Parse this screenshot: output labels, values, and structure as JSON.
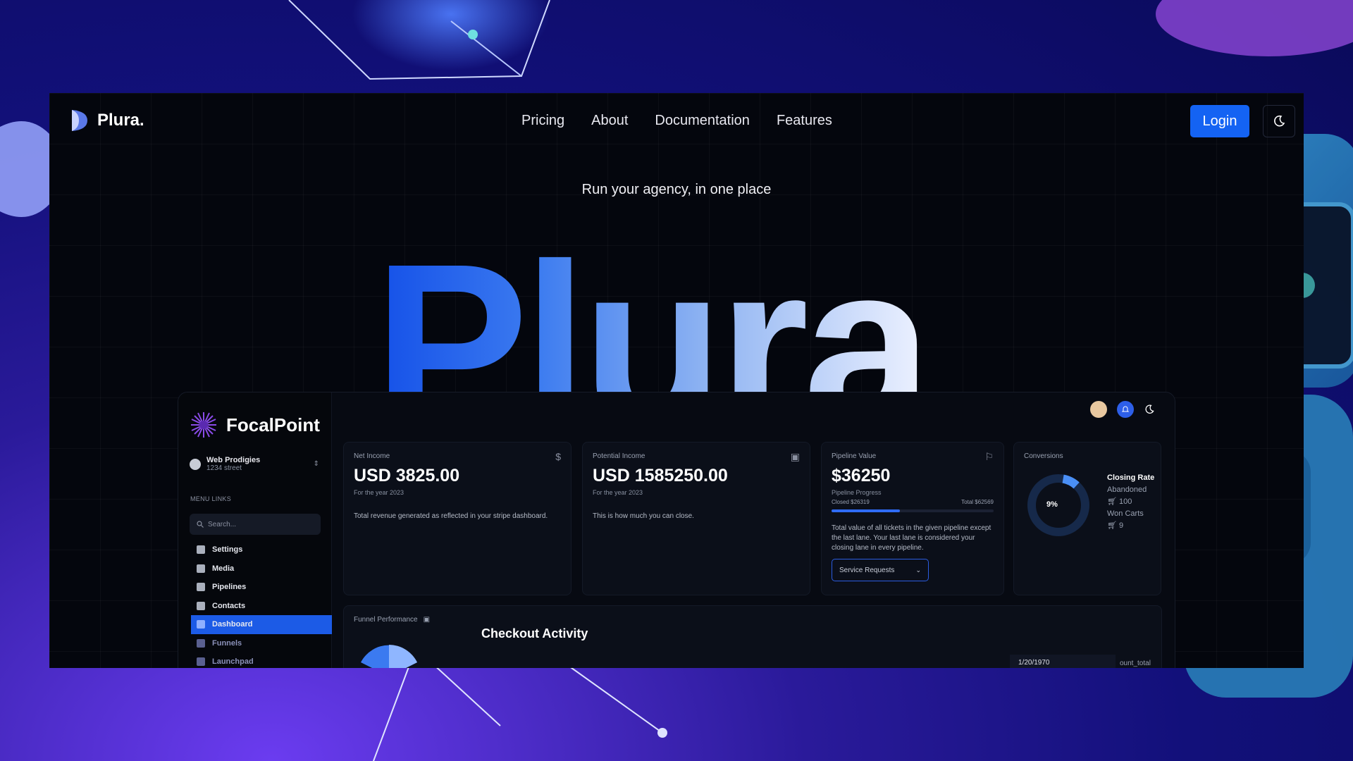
{
  "brand": {
    "name": "Plura."
  },
  "nav": {
    "links": [
      "Pricing",
      "About",
      "Documentation",
      "Features"
    ],
    "login_label": "Login"
  },
  "hero": {
    "tagline": "Run your agency, in one place",
    "big_word": "Plura"
  },
  "dashboard": {
    "brand_name": "FocalPoint",
    "account": {
      "name": "Web Prodigies",
      "address": "1234 street"
    },
    "menu_label": "MENU LINKS",
    "search_placeholder": "Search...",
    "menu_items": [
      "Settings",
      "Media",
      "Pipelines",
      "Contacts",
      "Dashboard",
      "Funnels",
      "Launchpad"
    ],
    "active_menu": "Dashboard",
    "cards": {
      "net_income": {
        "title": "Net Income",
        "value": "USD 3825.00",
        "sub": "For the year 2023",
        "desc": "Total revenue generated as reflected in your stripe dashboard."
      },
      "potential_income": {
        "title": "Potential Income",
        "value": "USD 1585250.00",
        "sub": "For the year 2023",
        "desc": "This is how much you can close."
      },
      "pipeline_value": {
        "title": "Pipeline Value",
        "value": "$36250",
        "sub": "Pipeline Progress",
        "closed": "Closed $26319",
        "total": "Total $62569",
        "progress": 0.42,
        "desc": "Total value of all tickets in the given pipeline except the last lane. Your last lane is considered your closing lane in every pipeline.",
        "select_value": "Service Requests"
      },
      "conversions": {
        "title": "Conversions",
        "percent": "9%",
        "closing_rate_label": "Closing Rate",
        "abandoned_label": "Abandoned",
        "abandoned_value": "100",
        "won_label": "Won Carts",
        "won_value": "9"
      }
    },
    "funnel_title": "Funnel Performance",
    "checkout_title": "Checkout Activity",
    "date_value": "1/20/1970",
    "count_label": "ount_total"
  },
  "colors": {
    "accent": "#1463f3",
    "bg": "#04060d",
    "purple": "#6b3cf0"
  }
}
